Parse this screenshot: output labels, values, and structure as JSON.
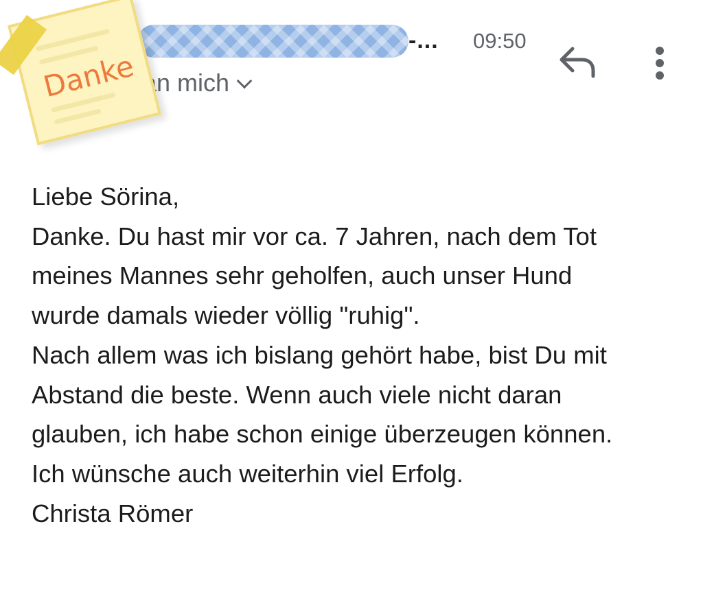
{
  "header": {
    "sender_suffix": "-...",
    "time": "09:50",
    "recipient": "an mich",
    "recipient_chevron": "chevron-down-icon",
    "reply_icon": "reply-icon",
    "more_icon": "more-vert-icon"
  },
  "logo": {
    "text": "Danke",
    "colors": {
      "note": "#fdf4c2",
      "tape": "#ecd247",
      "text": "#ec7a3c"
    }
  },
  "message": {
    "lines": [
      "Liebe Sörina,",
      "Danke. Du hast mir vor ca. 7 Jahren, nach dem Tot",
      "meines Mannes sehr geholfen, auch unser Hund",
      "wurde damals wieder völlig \"ruhig\".",
      "Nach allem was ich bislang gehört habe, bist Du mit",
      "Abstand die beste. Wenn auch viele nicht daran",
      "glauben, ich habe schon einige überzeugen können.",
      "Ich wünsche auch weiterhin viel Erfolg.",
      "Christa Römer"
    ]
  },
  "colors": {
    "redaction": "#8fb3e3",
    "secondary_text": "#5f6368",
    "body_text": "#1c1c1c"
  }
}
